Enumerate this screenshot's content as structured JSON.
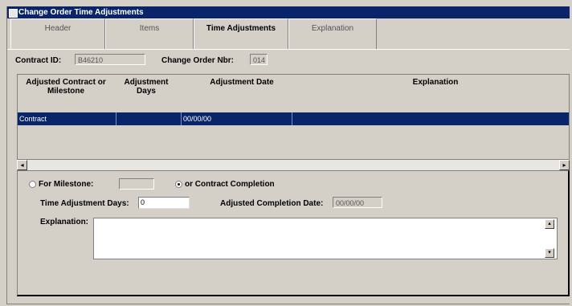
{
  "window": {
    "title": "Change Order Time Adjustments"
  },
  "tabs": [
    {
      "label": "Header"
    },
    {
      "label": "Items"
    },
    {
      "label": "Time Adjustments"
    },
    {
      "label": "Explanation"
    }
  ],
  "contract": {
    "contract_id_label": "Contract ID:",
    "contract_id_value": "B46210",
    "change_order_label": "Change Order Nbr:",
    "change_order_value": "014"
  },
  "grid": {
    "columns": [
      {
        "label": "Adjusted Contract or Milestone"
      },
      {
        "label": "Adjustment Days"
      },
      {
        "label": "Adjustment Date"
      },
      {
        "label": "Explanation"
      }
    ],
    "rows": [
      {
        "milestone": "Contract",
        "days": "",
        "date": "00/00/00",
        "explanation": ""
      }
    ]
  },
  "scroll": {
    "left_icon": "arrow-left",
    "right_icon": "arrow-right"
  },
  "form": {
    "milestone_radio_label": "For Milestone:",
    "milestone_value": "",
    "contract_completion_label": "or Contract Completion",
    "selected_option": "contract_completion",
    "days_label": "Time Adjustment Days:",
    "days_value": "0",
    "completion_date_label": "Adjusted Completion Date:",
    "completion_date_value": "00/00/00",
    "explanation_label": "Explanation:",
    "explanation_value": ""
  },
  "colors": {
    "title_bar": "#0a246a",
    "selection": "#0a246a",
    "window": "#d4d0c8"
  }
}
